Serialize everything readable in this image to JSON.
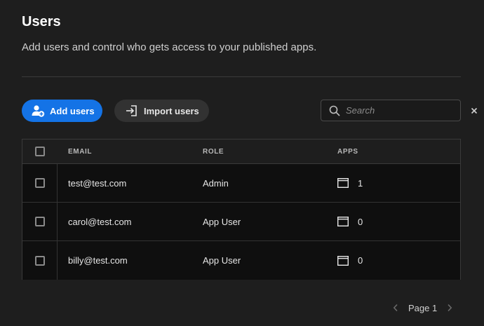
{
  "header": {
    "title": "Users",
    "subtitle": "Add users and control who gets access to your published apps."
  },
  "toolbar": {
    "add_users_label": "Add users",
    "import_users_label": "Import users",
    "search_placeholder": "Search",
    "search_value": ""
  },
  "table": {
    "columns": [
      "EMAIL",
      "ROLE",
      "APPS"
    ],
    "rows": [
      {
        "email": "test@test.com",
        "role": "Admin",
        "apps": "1"
      },
      {
        "email": "carol@test.com",
        "role": "App User",
        "apps": "0"
      },
      {
        "email": "billy@test.com",
        "role": "App User",
        "apps": "0"
      }
    ]
  },
  "pagination": {
    "label": "Page 1"
  },
  "colors": {
    "background": "#1e1e1e",
    "primary_button": "#1473e6",
    "secondary_button": "#323232",
    "table_body": "#0f0f0f"
  },
  "icons": {
    "add_users": "add-user-icon",
    "import_users": "import-icon",
    "search": "search-icon",
    "clear": "close-icon",
    "apps": "app-window-icon",
    "prev": "chevron-left-icon",
    "next": "chevron-right-icon"
  }
}
